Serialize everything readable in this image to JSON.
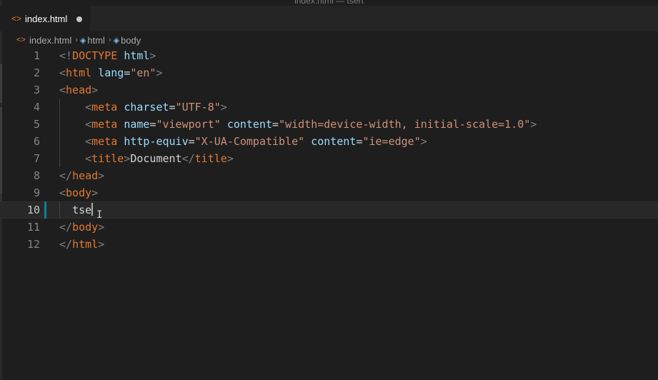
{
  "window": {
    "title": "index.html — tsert"
  },
  "tabs": [
    {
      "label": "index.html",
      "icon": "code-file-icon",
      "dirty": true
    }
  ],
  "breadcrumb": {
    "file": "index.html",
    "items": [
      "html",
      "body"
    ]
  },
  "editor": {
    "current_line": 10,
    "line_numbers": [
      "1",
      "2",
      "3",
      "4",
      "5",
      "6",
      "7",
      "8",
      "9",
      "10",
      "11",
      "12"
    ],
    "lines": [
      {
        "tokens": [
          {
            "t": "<!",
            "c": "punct"
          },
          {
            "t": "DOCTYPE",
            "c": "tag"
          },
          {
            "t": " ",
            "c": "text"
          },
          {
            "t": "html",
            "c": "attr"
          },
          {
            "t": ">",
            "c": "punct"
          }
        ]
      },
      {
        "tokens": [
          {
            "t": "<",
            "c": "punct"
          },
          {
            "t": "html",
            "c": "tag"
          },
          {
            "t": " ",
            "c": "text"
          },
          {
            "t": "lang",
            "c": "attr"
          },
          {
            "t": "=",
            "c": "text"
          },
          {
            "t": "\"en\"",
            "c": "str"
          },
          {
            "t": ">",
            "c": "punct"
          }
        ]
      },
      {
        "tokens": [
          {
            "t": "<",
            "c": "punct"
          },
          {
            "t": "head",
            "c": "tag"
          },
          {
            "t": ">",
            "c": "punct"
          }
        ]
      },
      {
        "tokens": [
          {
            "t": "    ",
            "c": "text"
          },
          {
            "t": "<",
            "c": "punct"
          },
          {
            "t": "meta",
            "c": "tag"
          },
          {
            "t": " ",
            "c": "text"
          },
          {
            "t": "charset",
            "c": "attr"
          },
          {
            "t": "=",
            "c": "text"
          },
          {
            "t": "\"UTF-8\"",
            "c": "str"
          },
          {
            "t": ">",
            "c": "punct"
          }
        ]
      },
      {
        "tokens": [
          {
            "t": "    ",
            "c": "text"
          },
          {
            "t": "<",
            "c": "punct"
          },
          {
            "t": "meta",
            "c": "tag"
          },
          {
            "t": " ",
            "c": "text"
          },
          {
            "t": "name",
            "c": "attr"
          },
          {
            "t": "=",
            "c": "text"
          },
          {
            "t": "\"viewport\"",
            "c": "str"
          },
          {
            "t": " ",
            "c": "text"
          },
          {
            "t": "content",
            "c": "attr"
          },
          {
            "t": "=",
            "c": "text"
          },
          {
            "t": "\"width=device-width, initial-scale=1.0\"",
            "c": "str"
          },
          {
            "t": ">",
            "c": "punct"
          }
        ]
      },
      {
        "tokens": [
          {
            "t": "    ",
            "c": "text"
          },
          {
            "t": "<",
            "c": "punct"
          },
          {
            "t": "meta",
            "c": "tag"
          },
          {
            "t": " ",
            "c": "text"
          },
          {
            "t": "http-equiv",
            "c": "attr"
          },
          {
            "t": "=",
            "c": "text"
          },
          {
            "t": "\"X-UA-Compatible\"",
            "c": "str"
          },
          {
            "t": " ",
            "c": "text"
          },
          {
            "t": "content",
            "c": "attr"
          },
          {
            "t": "=",
            "c": "text"
          },
          {
            "t": "\"ie=edge\"",
            "c": "str"
          },
          {
            "t": ">",
            "c": "punct"
          }
        ]
      },
      {
        "tokens": [
          {
            "t": "    ",
            "c": "text"
          },
          {
            "t": "<",
            "c": "punct"
          },
          {
            "t": "title",
            "c": "tag"
          },
          {
            "t": ">",
            "c": "punct"
          },
          {
            "t": "Document",
            "c": "text"
          },
          {
            "t": "</",
            "c": "punct"
          },
          {
            "t": "title",
            "c": "tag"
          },
          {
            "t": ">",
            "c": "punct"
          }
        ]
      },
      {
        "tokens": [
          {
            "t": "</",
            "c": "punct"
          },
          {
            "t": "head",
            "c": "tag"
          },
          {
            "t": ">",
            "c": "punct"
          }
        ]
      },
      {
        "tokens": [
          {
            "t": "<",
            "c": "punct"
          },
          {
            "t": "body",
            "c": "tag"
          },
          {
            "t": ">",
            "c": "punct"
          }
        ]
      },
      {
        "tokens": [
          {
            "t": "  ",
            "c": "text"
          },
          {
            "t": "tse",
            "c": "text"
          }
        ]
      },
      {
        "tokens": [
          {
            "t": "</",
            "c": "punct"
          },
          {
            "t": "body",
            "c": "tag"
          },
          {
            "t": ">",
            "c": "punct"
          }
        ]
      },
      {
        "tokens": [
          {
            "t": "</",
            "c": "punct"
          },
          {
            "t": "html",
            "c": "tag"
          },
          {
            "t": ">",
            "c": "punct"
          }
        ]
      }
    ]
  },
  "colors": {
    "background": "#1e1e1e",
    "tag": "#e37933",
    "attr": "#9cdcfe",
    "string": "#ce9178",
    "modified_bar": "#0c7d9d"
  }
}
